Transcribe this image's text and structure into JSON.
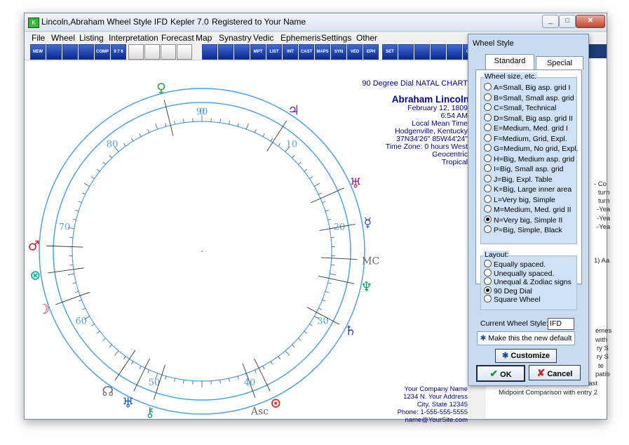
{
  "window": {
    "title": "Lincoln,Abraham Wheel Style IFD",
    "app_name": "Kepler 7.0",
    "registration": "Registered to Your Name"
  },
  "menu": [
    "File",
    "Wheel",
    "Listing",
    "Interpretation",
    "Forecast",
    "Map",
    "Synastry",
    "Vedic",
    "Ephemeris",
    "Settings",
    "Other"
  ],
  "toolbar": [
    "NEW",
    "",
    "",
    "",
    "COMP",
    "9 7 6",
    "",
    "",
    "",
    "",
    "",
    "",
    "",
    "MPT",
    "LIST",
    "INT",
    "CAST",
    "MAPS",
    "SYN",
    "VED",
    "EPH",
    "SET",
    "",
    "",
    "",
    "",
    "CAL"
  ],
  "chart": {
    "header": "90 Degree Dial NATAL CHART",
    "name": "Abraham Lincoln",
    "date": "February 12, 1809",
    "time": "6:54 AM",
    "time_type": "Local Mean Time",
    "place": "Hodgenville, Kentucky",
    "coords": "37N34'26\"  85W44'24\"",
    "timezone": "Time Zone: 0 hours West",
    "system": "Geocentric",
    "zodiac": "Tropical",
    "dial_labels": [
      "0",
      "10",
      "20",
      "30",
      "40",
      "50",
      "60",
      "70",
      "80",
      "90"
    ],
    "point_labels": [
      "MC",
      "Asc"
    ],
    "company": [
      "Your Company Name",
      "1234 N. Your Address",
      "City, State 12345",
      "Phone: 1-555-555-5555",
      "name@YourSite.com"
    ],
    "wheel_color": "#4aa3e6"
  },
  "background_panel": {
    "fragments": [
      "- Co",
      "turn",
      "turn",
      "-Yea",
      "-Yea",
      "-Yea",
      "1) Aa",
      "emes",
      "with",
      "ry S",
      "ry S",
      "te",
      "patib",
      "TRI: Interp DAL, Cosmo Forecast",
      "Midpoint Comparison  with entry 2"
    ]
  },
  "dialog": {
    "title": "Wheel Style",
    "tabs": [
      "Standard",
      "Special"
    ],
    "size_group_label": "Wheel size, etc.",
    "size_options": [
      "A=Small, Big asp. grid I",
      "B=Small, Small asp. grid",
      "C=Small, Technical",
      "D=Small, Big asp. grid II",
      "E=Medium, Med. grid I",
      "F=Medium, Grid,  Expl.",
      "G=Medium, No grid, Expl.",
      "H=Big, Medium asp. grid",
      "I=Big, Small asp. grid",
      "J=Big, Expl. Table",
      "K=Big, Large inner area",
      "L=Very big, Simple",
      "M=Medium, Med. grid II",
      "N=Very big, Simple II",
      "P=Big, Simple, Black"
    ],
    "size_selected": 13,
    "layout_label": "Layout:",
    "layout_options": [
      "Equally spaced.",
      "Unequally spaced.",
      "Unequal & Zodiac signs",
      "90 Deg Dial",
      "Square Wheel"
    ],
    "layout_selected": 3,
    "current_style_label": "Current Wheel Style:",
    "current_style_value": "IFD",
    "make_default": "Make this the new default",
    "customize": "Customize",
    "ok": "OK",
    "cancel": "Cancel"
  }
}
